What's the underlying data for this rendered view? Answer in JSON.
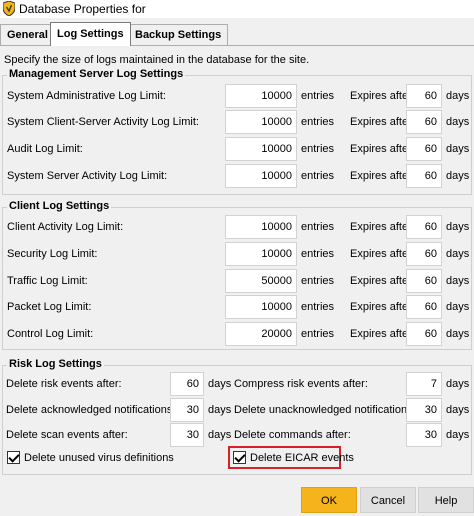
{
  "window": {
    "title": "Database Properties for"
  },
  "tabs": [
    {
      "label": "General"
    },
    {
      "label": "Log Settings"
    },
    {
      "label": "Backup Settings"
    }
  ],
  "description": "Specify the size of logs maintained in the database for the site.",
  "management": {
    "title": "Management Server Log Settings",
    "rows": [
      {
        "label": "System Administrative Log Limit:",
        "value": "10000",
        "unit": "entries",
        "expires_label": "Expires after:",
        "days": "60",
        "days_label": "days"
      },
      {
        "label": "System Client-Server Activity Log Limit:",
        "value": "10000",
        "unit": "entries",
        "expires_label": "Expires after:",
        "days": "60",
        "days_label": "days"
      },
      {
        "label": "Audit Log Limit:",
        "value": "10000",
        "unit": "entries",
        "expires_label": "Expires after:",
        "days": "60",
        "days_label": "days"
      },
      {
        "label": "System Server Activity Log Limit:",
        "value": "10000",
        "unit": "entries",
        "expires_label": "Expires after:",
        "days": "60",
        "days_label": "days"
      }
    ]
  },
  "client": {
    "title": "Client Log Settings",
    "rows": [
      {
        "label": "Client Activity Log Limit:",
        "value": "10000",
        "unit": "entries",
        "expires_label": "Expires after:",
        "days": "60",
        "days_label": "days"
      },
      {
        "label": "Security Log Limit:",
        "value": "10000",
        "unit": "entries",
        "expires_label": "Expires after:",
        "days": "60",
        "days_label": "days"
      },
      {
        "label": "Traffic Log Limit:",
        "value": "50000",
        "unit": "entries",
        "expires_label": "Expires after:",
        "days": "60",
        "days_label": "days"
      },
      {
        "label": "Packet Log Limit:",
        "value": "10000",
        "unit": "entries",
        "expires_label": "Expires after:",
        "days": "60",
        "days_label": "days"
      },
      {
        "label": "Control Log Limit:",
        "value": "20000",
        "unit": "entries",
        "expires_label": "Expires after:",
        "days": "60",
        "days_label": "days"
      }
    ]
  },
  "risk": {
    "title": "Risk Log Settings",
    "rows": [
      {
        "left_label": "Delete risk events after:",
        "left_value": "60",
        "left_unit": "days",
        "right_label": "Compress risk events after:",
        "right_value": "7",
        "right_unit": "days"
      },
      {
        "left_label": "Delete acknowledged notifications after:",
        "left_value": "30",
        "left_unit": "days",
        "right_label": "Delete unacknowledged notifications after:",
        "right_value": "30",
        "right_unit": "days"
      },
      {
        "left_label": "Delete scan events after:",
        "left_value": "30",
        "left_unit": "days",
        "right_label": "Delete commands after:",
        "right_value": "30",
        "right_unit": "days"
      }
    ],
    "checkboxes": [
      {
        "label": "Delete unused virus definitions",
        "checked": true
      },
      {
        "label": "Delete EICAR events",
        "checked": true
      }
    ]
  },
  "buttons": {
    "ok": "OK",
    "cancel": "Cancel",
    "help": "Help"
  },
  "colors": {
    "ok_button": "#f5b41b",
    "highlight": "#d8202a",
    "icon": "#f3b51b"
  }
}
